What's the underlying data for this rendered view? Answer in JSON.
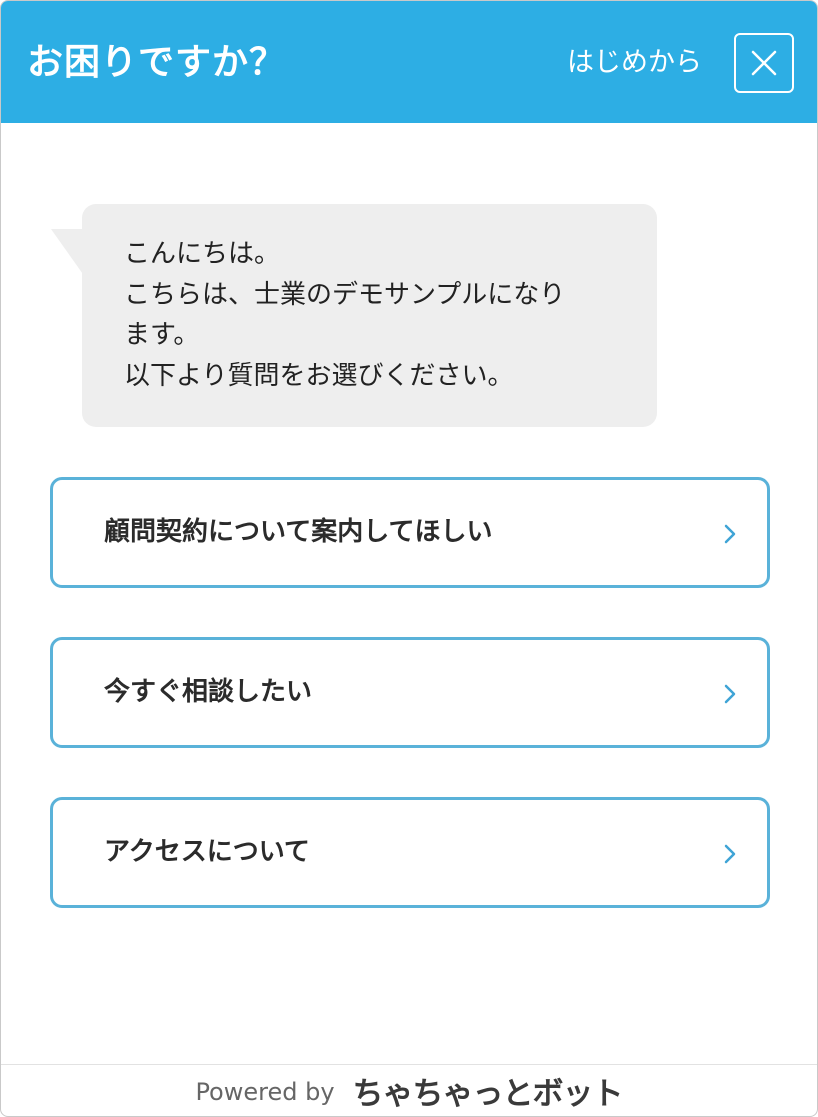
{
  "header": {
    "title": "お困りですか？",
    "restart_label": "はじめから",
    "close_icon": "close-icon"
  },
  "message": {
    "lines": [
      "こんにちは。",
      "こちらは、士業のデモサンプルになり",
      "ます。",
      "以下より質問をお選びください。"
    ]
  },
  "options": [
    {
      "label": "顧問契約について案内してほしい",
      "icon": "chevron-right-icon"
    },
    {
      "label": "今すぐ相談したい",
      "icon": "chevron-right-icon"
    },
    {
      "label": "アクセスについて",
      "icon": "chevron-right-icon"
    }
  ],
  "footer": {
    "powered_by": "Powered by",
    "brand": "ちゃちゃっとボット"
  },
  "colors": {
    "accent": "#2daee4",
    "bubble": "#eeeeee",
    "button_border": "#5ab2d9",
    "chevron": "#3fa4d6"
  }
}
